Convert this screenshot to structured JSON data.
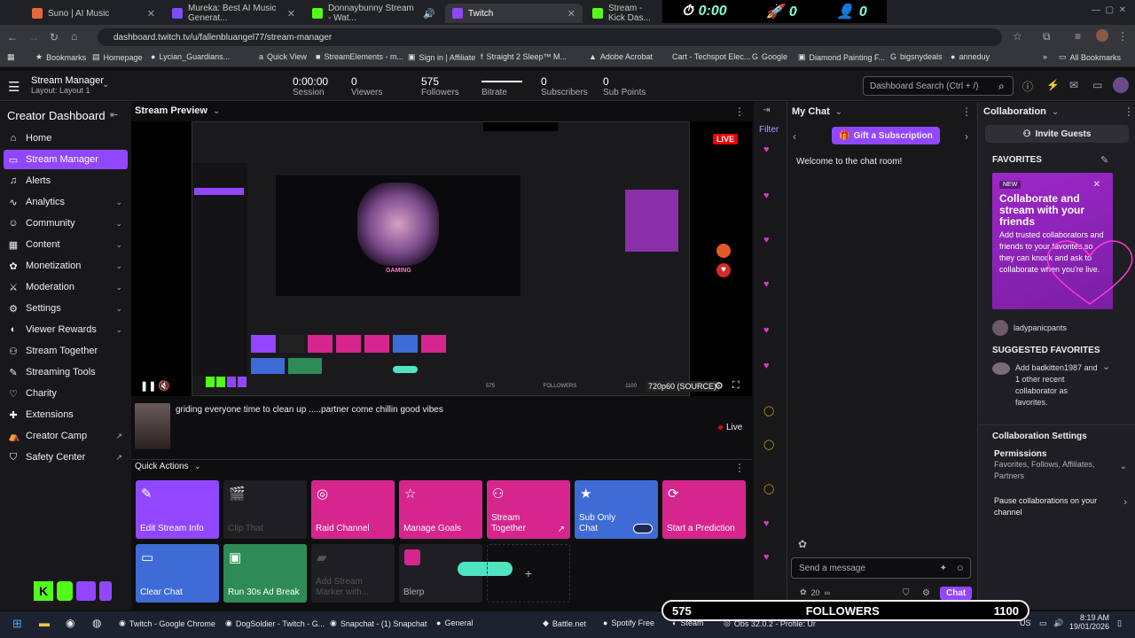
{
  "browser": {
    "tabs": [
      {
        "label": "Suno | AI Music",
        "color": "#e8663d"
      },
      {
        "label": "Mureka: Best AI Music Generat...",
        "color": "#7b4dff"
      },
      {
        "label": "Donnaybunny Stream - Wat...",
        "color": "#53fc18"
      },
      {
        "label": "Twitch",
        "color": "#9146ff"
      },
      {
        "label": "Stream - Kick Das...",
        "color": "#53fc18"
      }
    ],
    "overlay": {
      "timer": "0:00",
      "rockets": "0",
      "users": "0"
    },
    "url": "dashboard.twitch.tv/u/fallenbluangel77/stream-manager",
    "bookmarks": [
      "Bookmarks",
      "Homepage",
      "Lycian_Guardians...",
      "Quick View",
      "StreamElements - m...",
      "Sign in | Affiliate",
      "Straight 2 Sleep™ M...",
      "Adobe Acrobat",
      "Cart - Techspot Elec...",
      "Google",
      "Diamond Painting F...",
      "bigsnydeals",
      "anneduy"
    ],
    "all_bookmarks": "All Bookmarks"
  },
  "topbar": {
    "title": "Stream Manager",
    "layout": "Layout: Layout 1",
    "stats": [
      {
        "value": "0:00:00",
        "label": "Session"
      },
      {
        "value": "0",
        "label": "Viewers"
      },
      {
        "value": "575",
        "label": "Followers"
      },
      {
        "value": "",
        "label": "Bitrate"
      },
      {
        "value": "0",
        "label": "Subscribers"
      },
      {
        "value": "0",
        "label": "Sub Points"
      }
    ],
    "search_placeholder": "Dashboard Search (Ctrl + /)"
  },
  "sidebar": {
    "heading": "Creator Dashboard",
    "items": [
      {
        "label": "Home",
        "icon": "home-icon"
      },
      {
        "label": "Stream Manager",
        "icon": "stream-icon",
        "active": true
      },
      {
        "label": "Alerts",
        "icon": "bell-icon"
      },
      {
        "label": "Analytics",
        "icon": "chart-icon",
        "expand": true
      },
      {
        "label": "Community",
        "icon": "people-icon",
        "expand": true
      },
      {
        "label": "Content",
        "icon": "content-icon",
        "expand": true
      },
      {
        "label": "Monetization",
        "icon": "coin-icon",
        "expand": true
      },
      {
        "label": "Moderation",
        "icon": "sword-icon",
        "expand": true
      },
      {
        "label": "Settings",
        "icon": "gear-icon",
        "expand": true
      },
      {
        "label": "Viewer Rewards",
        "icon": "reward-icon",
        "expand": true
      },
      {
        "label": "Stream Together",
        "icon": "together-icon"
      },
      {
        "label": "Streaming Tools",
        "icon": "tools-icon"
      },
      {
        "label": "Charity",
        "icon": "heart-icon"
      },
      {
        "label": "Extensions",
        "icon": "puzzle-icon"
      },
      {
        "label": "Creator Camp",
        "icon": "camp-icon",
        "external": true
      },
      {
        "label": "Safety Center",
        "icon": "shield-icon",
        "external": true
      }
    ]
  },
  "preview": {
    "title": "Stream Preview",
    "live": "LIVE",
    "quality": "720p60 (SOURCE)",
    "stream_title": "griding everyone time to clean up .....partner come chillin good vibes",
    "live_status": "Live",
    "followers_label": "FOLLOWERS"
  },
  "quick_actions": {
    "title": "Quick Actions",
    "items": [
      {
        "label": "Edit Stream Info",
        "color": "#9147ff"
      },
      {
        "label": "Clip That",
        "color": "#1f1f23",
        "disabled": true
      },
      {
        "label": "Raid Channel",
        "color": "#d6268e"
      },
      {
        "label": "Manage Goals",
        "color": "#d6268e"
      },
      {
        "label": "Stream Together",
        "color": "#d6268e"
      },
      {
        "label": "Sub Only Chat",
        "color": "#3f6bd6"
      },
      {
        "label": "Start a Prediction",
        "color": "#d6268e"
      },
      {
        "label": "Clear Chat",
        "color": "#3f6bd6"
      },
      {
        "label": "Run 30s Ad Break",
        "color": "#2e8b57"
      },
      {
        "label": "Add Stream Marker with...",
        "color": "#1f1f23",
        "disabled": true
      },
      {
        "label": "Blerp",
        "color": "#1f1f23"
      }
    ]
  },
  "events": {
    "filter": "Filter"
  },
  "chat": {
    "title": "My Chat",
    "gift_button": "Gift a Subscription",
    "welcome": "Welcome to the chat room!",
    "input_placeholder": "Send a message",
    "chat_button": "Chat",
    "count": "20"
  },
  "collab": {
    "title": "Collaboration",
    "invite": "Invite Guests",
    "favorites_heading": "FAVORITES",
    "new_badge": "NEW",
    "promo_title": "Collaborate and stream with your friends",
    "promo_body": "Add trusted collaborators and friends to your favorites so they can knock and ask to collaborate when you're live.",
    "favorite_user": "ladypanicpants",
    "suggested_heading": "SUGGESTED FAVORITES",
    "suggested_text": "Add badkitten1987 and 1 other recent collaborator as favorites.",
    "settings_heading": "Collaboration Settings",
    "permissions_label": "Permissions",
    "permissions_value": "Favorites, Follows, Affiliates, Partners",
    "pause_label": "Pause collaborations on your channel"
  },
  "follower_goal": {
    "current": "575",
    "label": "FOLLOWERS",
    "target": "1100"
  },
  "taskbar": {
    "items": [
      "Twitch - Google Chrome",
      "DogSoldier - Twitch - G...",
      "Snapchat - (1) Snapchat",
      "General",
      "Battle.net",
      "Spotify Free",
      "Steam",
      "Obs 32.0.2 - Profile: Unt"
    ],
    "time": "8:19 AM",
    "date": "19/01/2026",
    "locale": "US"
  }
}
